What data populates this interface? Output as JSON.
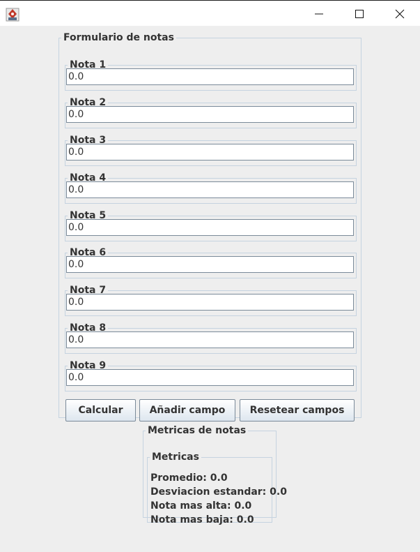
{
  "window": {
    "icon": "java-app-icon",
    "minimize_icon": "minimize-icon",
    "maximize_icon": "maximize-icon",
    "close_icon": "close-icon"
  },
  "form": {
    "title": "Formulario de notas",
    "fields": [
      {
        "label": "Nota 1",
        "value": "0.0"
      },
      {
        "label": "Nota 2",
        "value": "0.0"
      },
      {
        "label": "Nota 3",
        "value": "0.0"
      },
      {
        "label": "Nota 4",
        "value": "0.0"
      },
      {
        "label": "Nota 5",
        "value": "0.0"
      },
      {
        "label": "Nota 6",
        "value": "0.0"
      },
      {
        "label": "Nota 7",
        "value": "0.0"
      },
      {
        "label": "Nota 8",
        "value": "0.0"
      },
      {
        "label": "Nota 9",
        "value": "0.0"
      }
    ],
    "buttons": {
      "calcular": "Calcular",
      "anadir": "Añadir campo",
      "resetear": "Resetear campos"
    }
  },
  "metrics": {
    "title": "Metricas de notas",
    "subtitle": "Metricas",
    "promedio": "Promedio: 0.0",
    "desviacion": "Desviacion estandar: 0.0",
    "alta": "Nota mas alta: 0.0",
    "baja": "Nota mas baja: 0.0"
  }
}
